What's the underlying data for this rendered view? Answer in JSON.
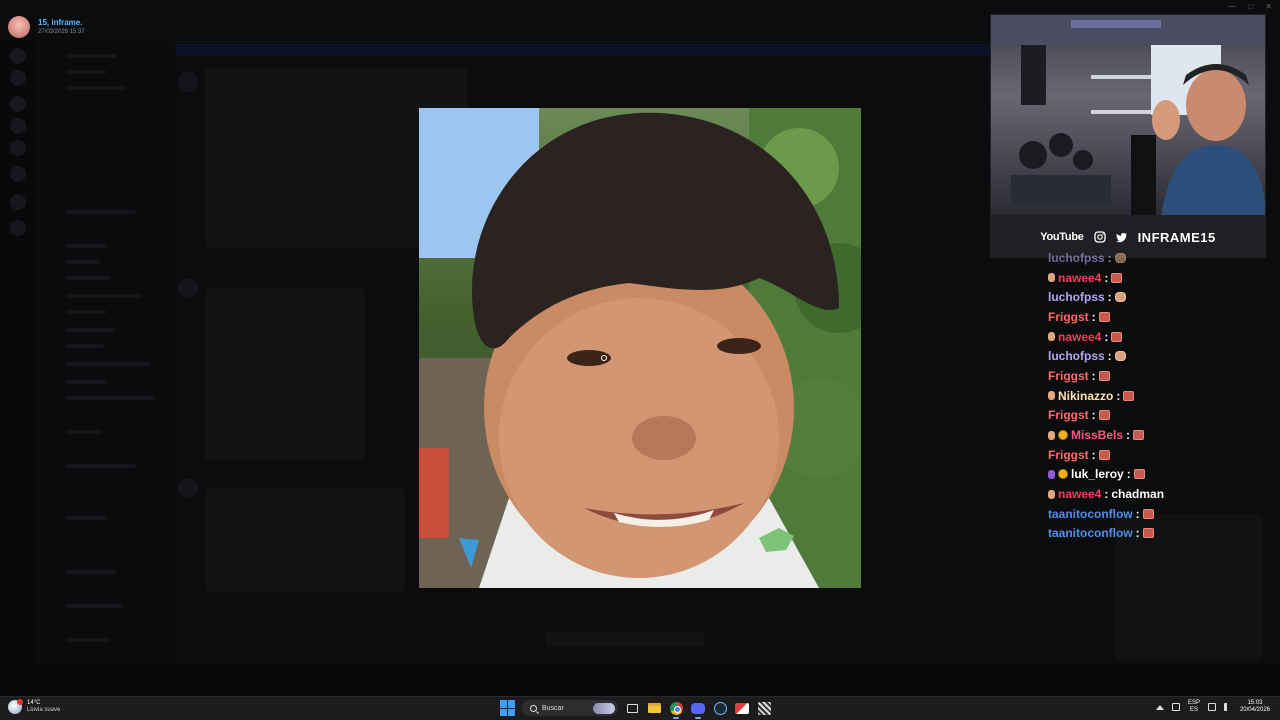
{
  "header": {
    "user_name": "15, inframe.",
    "date": "27/03/2026 15:37"
  },
  "window": {
    "minimize": "—",
    "maximize": "□",
    "close": "✕"
  },
  "stream_overlay": {
    "social_youtube": "YouTube",
    "social_handle": "INFRAME15",
    "icons": [
      "instagram-icon",
      "twitter-icon"
    ]
  },
  "chat": {
    "messages": [
      {
        "user": "luchofpss",
        "color": "#b7a4f5",
        "badge": "",
        "emote": "hand",
        "text": "",
        "partial": true
      },
      {
        "user": "nawee4",
        "color": "#ff3b5c",
        "badge": "hand",
        "emote": "block",
        "text": ""
      },
      {
        "user": "luchofpss",
        "color": "#b7a4f5",
        "badge": "",
        "emote": "hand",
        "text": ""
      },
      {
        "user": "Friggst",
        "color": "#ff6a6a",
        "badge": "",
        "emote": "block",
        "text": ""
      },
      {
        "user": "nawee4",
        "color": "#ff3b5c",
        "badge": "hand",
        "emote": "block",
        "text": ""
      },
      {
        "user": "luchofpss",
        "color": "#b7a4f5",
        "badge": "",
        "emote": "hand",
        "text": ""
      },
      {
        "user": "Friggst",
        "color": "#ff6a6a",
        "badge": "",
        "emote": "block",
        "text": ""
      },
      {
        "user": "Nikinazzo",
        "color": "#ffe1b0",
        "badge": "hand",
        "emote": "block",
        "text": ""
      },
      {
        "user": "Friggst",
        "color": "#ff6a6a",
        "badge": "",
        "emote": "block",
        "text": ""
      },
      {
        "user": "MissBels",
        "color": "#ff5a7d",
        "badge": "hand-coin",
        "emote": "block",
        "text": ""
      },
      {
        "user": "Friggst",
        "color": "#ff6a6a",
        "badge": "",
        "emote": "block",
        "text": ""
      },
      {
        "user": "luk_leroy",
        "color": "#ffffff",
        "badge": "purple-coin",
        "emote": "block",
        "text": ""
      },
      {
        "user": "nawee4",
        "color": "#ff3b5c",
        "badge": "hand",
        "emote": "",
        "text": "chadman"
      },
      {
        "user": "taanitoconflow",
        "color": "#4f8fe8",
        "badge": "",
        "emote": "block",
        "text": ""
      },
      {
        "user": "taanitoconflow",
        "color": "#4f8fe8",
        "badge": "",
        "emote": "block",
        "text": ""
      }
    ]
  },
  "taskbar": {
    "weather_temp": "14°C",
    "weather_desc": "Lluvia suave",
    "search_label": "Buscar",
    "lang_top": "ESP",
    "lang_bottom": "ES",
    "time": "15:03",
    "date": "20/04/2026",
    "apps": [
      "task-view-icon",
      "file-explorer-icon",
      "chrome-icon",
      "discord-icon",
      "steam-icon",
      "streaming-app-icon",
      "grid-app-icon"
    ]
  }
}
